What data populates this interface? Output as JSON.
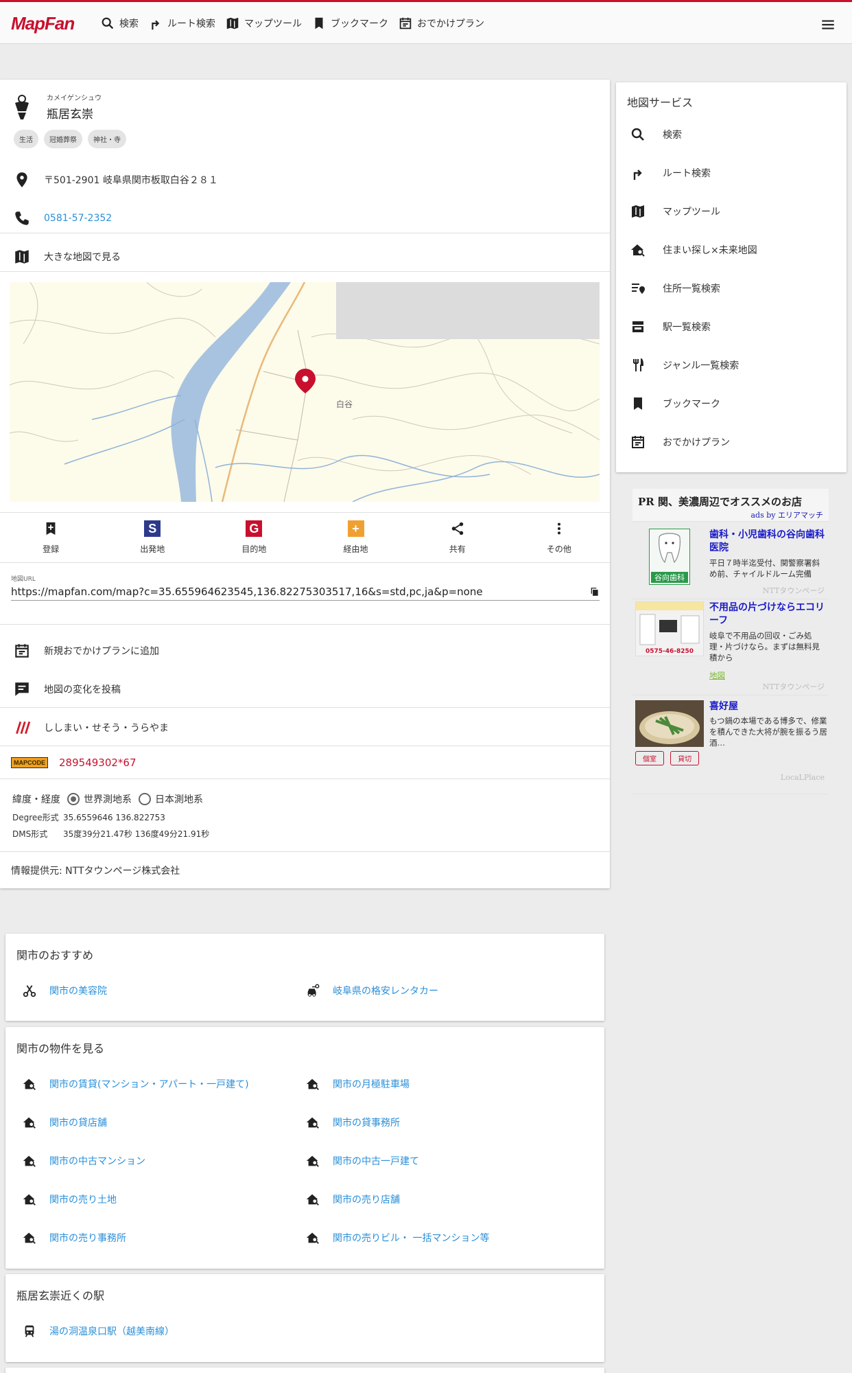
{
  "header": {
    "logo": "MapFan",
    "nav": [
      {
        "label": "検索",
        "icon": "search-icon"
      },
      {
        "label": "ルート検索",
        "icon": "route-icon"
      },
      {
        "label": "マップツール",
        "icon": "map-icon"
      },
      {
        "label": "ブックマーク",
        "icon": "bookmark-icon"
      },
      {
        "label": "おでかけプラン",
        "icon": "calendar-icon"
      }
    ],
    "menu_icon": "hamburger-menu-icon"
  },
  "place": {
    "kana": "カメイゲンシュウ",
    "name": "瓶居玄崇",
    "tags": [
      "生活",
      "冠婚葬祭",
      "神社・寺"
    ],
    "address": "〒501-2901 岐阜県関市板取白谷２８１",
    "phone": "0581-57-2352",
    "big_map": "大きな地図で見る",
    "map_label": "白谷"
  },
  "actions": [
    {
      "label": "登録",
      "icon": "bookmark-add-icon"
    },
    {
      "label": "出発地",
      "icon": "start-icon",
      "glyph": "S",
      "color": "#2d3a8c"
    },
    {
      "label": "目的地",
      "icon": "goal-icon",
      "glyph": "G",
      "color": "#c8102e"
    },
    {
      "label": "経由地",
      "icon": "waypoint-icon",
      "glyph": "+",
      "color": "#f0a030"
    },
    {
      "label": "共有",
      "icon": "share-icon"
    },
    {
      "label": "その他",
      "icon": "more-icon"
    }
  ],
  "url": {
    "label": "地図URL",
    "value": "https://mapfan.com/map?c=35.655964623545,136.82275303517,16&s=std,pc,ja&p=none"
  },
  "extra": {
    "plan": "新規おでかけプランに追加",
    "post": "地図の変化を投稿",
    "w3w": "ししまい・せそう・うらやま",
    "mapcode_logo": "MAPCODE",
    "mapcode": "289549302*67"
  },
  "coords": {
    "label": "緯度・経度",
    "world": "世界測地系",
    "japan": "日本測地系",
    "degree_label": "Degree形式",
    "degree": "35.6559646 136.822753",
    "dms_label": "DMS形式",
    "dms": "35度39分21.47秒 136度49分21.91秒"
  },
  "provider": "情報提供元: NTTタウンページ株式会社",
  "services": {
    "title": "地図サービス",
    "items": [
      {
        "label": "検索",
        "icon": "search-icon"
      },
      {
        "label": "ルート検索",
        "icon": "route-icon"
      },
      {
        "label": "マップツール",
        "icon": "map-icon"
      },
      {
        "label": "住まい探し×未来地図",
        "icon": "house-search-icon"
      },
      {
        "label": "住所一覧検索",
        "icon": "address-list-icon"
      },
      {
        "label": "駅一覧検索",
        "icon": "station-icon"
      },
      {
        "label": "ジャンル一覧検索",
        "icon": "restaurant-icon"
      },
      {
        "label": "ブックマーク",
        "icon": "bookmark-icon"
      },
      {
        "label": "おでかけプラン",
        "icon": "calendar-icon"
      }
    ]
  },
  "ads": {
    "title": "PR 関、美濃周辺でオススメのお店",
    "by": "ads by エリアマッチ",
    "items": [
      {
        "title": "歯科・小児歯科の谷向歯科医院",
        "desc": "平日７時半迄受付、関警察署斜め前、チャイルドルーム完備",
        "source": "NTTタウンページ",
        "img_text": "谷向歯科"
      },
      {
        "title": "不用品の片づけならエコリーフ",
        "desc": "岐阜で不用品の回収・ごみ処理・片づけなら。まずは無料見積から",
        "link": "地図",
        "source": "NTTタウンページ",
        "img_text": "0575-46-8250"
      },
      {
        "title": "喜好屋",
        "desc": "もつ鍋の本場である博多で、修業を積んできた大将が腕を振るう居酒…",
        "chips": [
          "個室",
          "貸切"
        ],
        "source": "LocaLPlace"
      }
    ]
  },
  "recommend": {
    "title": "関市のおすすめ",
    "items": [
      {
        "label": "関市の美容院",
        "icon": "scissors-icon"
      },
      {
        "label": "岐阜県の格安レンタカー",
        "icon": "car-rental-icon"
      }
    ]
  },
  "properties": {
    "title": "関市の物件を見る",
    "items": [
      {
        "label": "関市の賃貸(マンション・アパート・一戸建て)"
      },
      {
        "label": "関市の月極駐車場"
      },
      {
        "label": "関市の貸店舗"
      },
      {
        "label": "関市の貸事務所"
      },
      {
        "label": "関市の中古マンション"
      },
      {
        "label": "関市の中古一戸建て"
      },
      {
        "label": "関市の売り土地"
      },
      {
        "label": "関市の売り店舗"
      },
      {
        "label": "関市の売り事務所"
      },
      {
        "label": "関市の売りビル・ 一括マンション等"
      }
    ]
  },
  "stations": {
    "title": "瓶居玄崇近くの駅",
    "items": [
      {
        "label": "湯の洞温泉口駅（越美南線）"
      }
    ]
  }
}
